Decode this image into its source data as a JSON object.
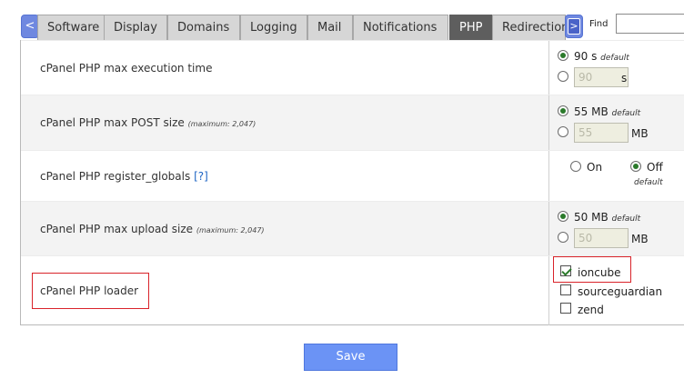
{
  "tabs": {
    "prev_label": "<",
    "next_label": ">",
    "items": [
      {
        "label": "Software"
      },
      {
        "label": "Display"
      },
      {
        "label": "Domains"
      },
      {
        "label": "Logging"
      },
      {
        "label": "Mail"
      },
      {
        "label": "Notifications"
      },
      {
        "label": "PHP"
      },
      {
        "label": "Redirection"
      }
    ],
    "active": "PHP"
  },
  "find": {
    "label": "Find",
    "value": ""
  },
  "settings": {
    "max_execution_time": {
      "label": "cPanel PHP max execution time",
      "default_value": "90 s",
      "default_tag": "default",
      "custom_value": "90",
      "unit": "s",
      "selected": "default"
    },
    "max_post_size": {
      "label": "cPanel PHP max POST size",
      "note": "(maximum: 2,047)",
      "default_value": "55 MB",
      "default_tag": "default",
      "custom_value": "55",
      "unit": "MB",
      "selected": "default"
    },
    "register_globals": {
      "label": "cPanel PHP register_globals",
      "help": "[?]",
      "on_label": "On",
      "off_label": "Off",
      "default_tag": "default",
      "selected": "off"
    },
    "max_upload_size": {
      "label": "cPanel PHP max upload size",
      "note": "(maximum: 2,047)",
      "default_value": "50 MB",
      "default_tag": "default",
      "custom_value": "50",
      "unit": "MB",
      "selected": "default"
    },
    "loader": {
      "label": "cPanel PHP loader",
      "options": [
        {
          "label": "ioncube",
          "checked": true
        },
        {
          "label": "sourceguardian",
          "checked": false
        },
        {
          "label": "zend",
          "checked": false
        }
      ]
    }
  },
  "save_label": "Save",
  "colors": {
    "accent": "#6b93f5",
    "highlight": "#d9232a",
    "selected_radio": "#2b7a2b"
  }
}
